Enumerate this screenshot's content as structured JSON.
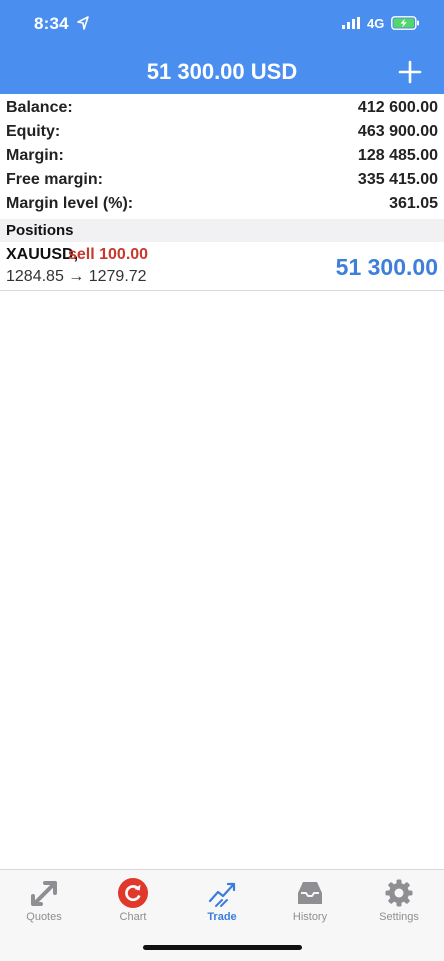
{
  "status_bar": {
    "time": "8:34",
    "network": "4G"
  },
  "header": {
    "balance_title": "51 300.00 USD"
  },
  "summary": [
    {
      "label": "Balance:",
      "value": "412 600.00"
    },
    {
      "label": "Equity:",
      "value": "463 900.00"
    },
    {
      "label": "Margin:",
      "value": "128 485.00"
    },
    {
      "label": "Free margin:",
      "value": "335 415.00"
    },
    {
      "label": "Margin level (%):",
      "value": "361.05"
    }
  ],
  "positions": {
    "header": "Positions",
    "items": [
      {
        "symbol": "XAUUSD,",
        "side": "sell 100.00",
        "prices": "1284.85 → 1279.72",
        "profit": "51 300.00"
      }
    ]
  },
  "tabbar": {
    "tabs": [
      {
        "label": "Quotes",
        "icon": "quotes-icon"
      },
      {
        "label": "Chart",
        "icon": "chart-icon"
      },
      {
        "label": "Trade",
        "icon": "trade-icon",
        "active": true
      },
      {
        "label": "History",
        "icon": "history-icon"
      },
      {
        "label": "Settings",
        "icon": "settings-icon"
      }
    ]
  },
  "colors": {
    "header": "#4a8ef0",
    "accent": "#3b7ddd",
    "sell": "#c8382e",
    "profit": "#3d7fd9",
    "badge": "#e0392b"
  }
}
